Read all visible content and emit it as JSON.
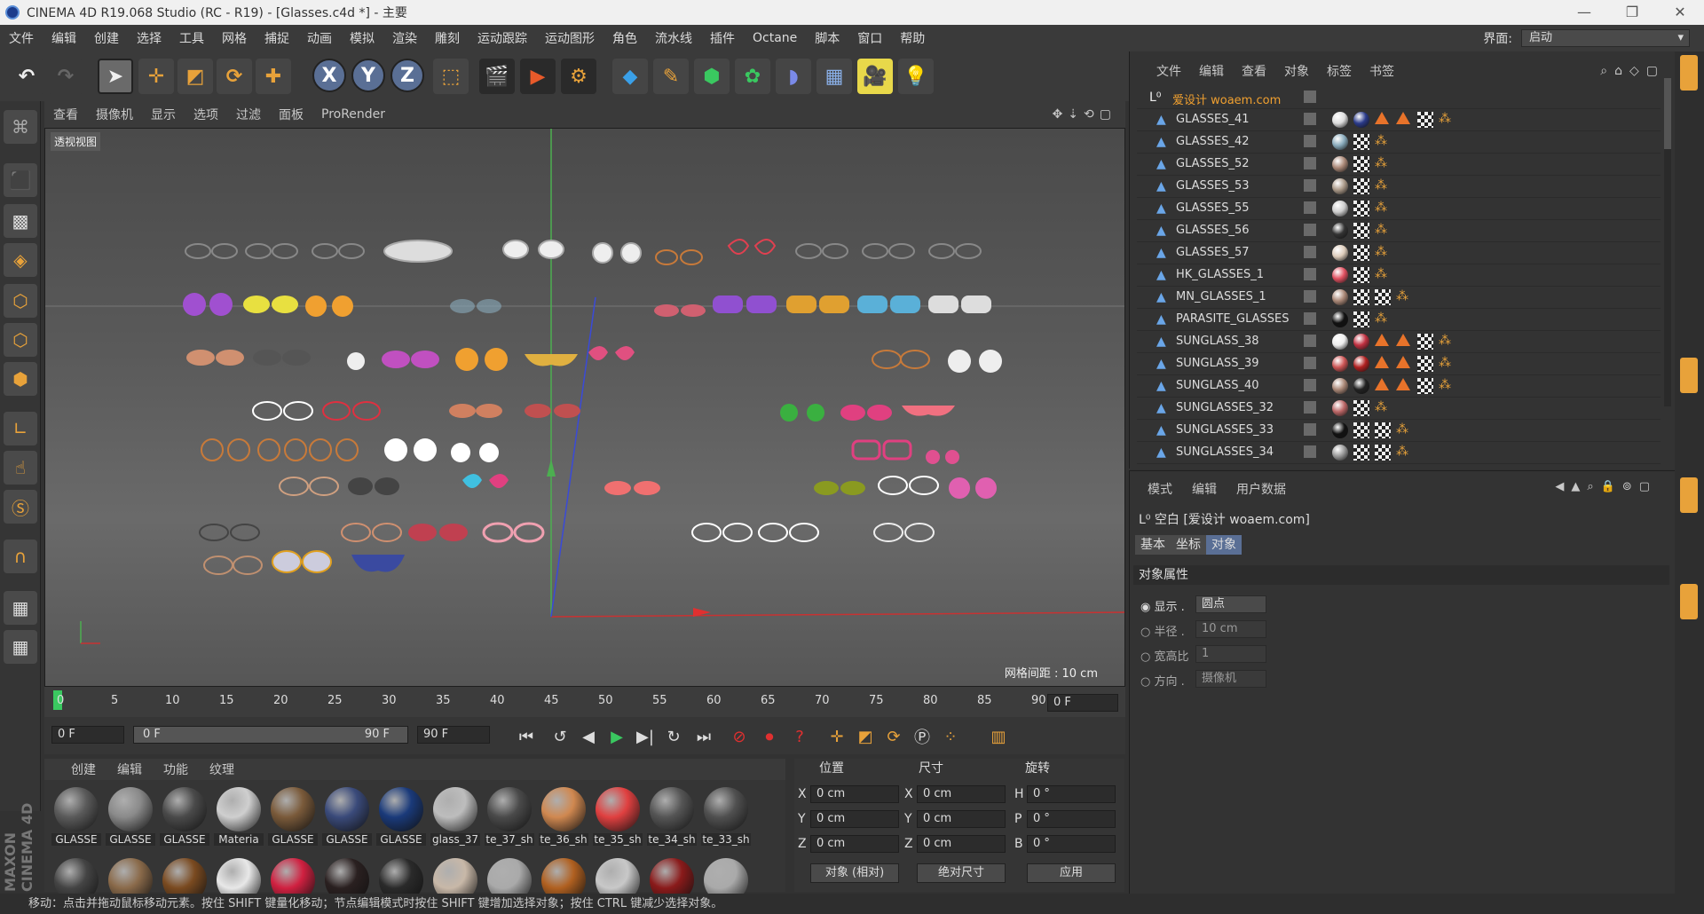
{
  "window": {
    "title": "CINEMA 4D R19.068 Studio (RC - R19) - [Glasses.c4d *] - 主要"
  },
  "menubar": {
    "items": [
      "文件",
      "编辑",
      "创建",
      "选择",
      "工具",
      "网格",
      "捕捉",
      "动画",
      "模拟",
      "渲染",
      "雕刻",
      "运动跟踪",
      "运动图形",
      "角色",
      "流水线",
      "插件",
      "Octane",
      "脚本",
      "窗口",
      "帮助"
    ],
    "layout_label": "界面:",
    "layout_value": "启动"
  },
  "viewport": {
    "menu": [
      "查看",
      "摄像机",
      "显示",
      "选项",
      "过滤",
      "面板",
      "ProRender"
    ],
    "view_name": "透视视图",
    "grid_spacing": "网格间距 : 10 cm"
  },
  "timeline": {
    "ticks": [
      "0",
      "5",
      "10",
      "15",
      "20",
      "25",
      "30",
      "35",
      "40",
      "45",
      "50",
      "55",
      "60",
      "65",
      "70",
      "75",
      "80",
      "85",
      "90"
    ],
    "current_frame": "0 F",
    "start_frame": "0 F",
    "range_start": "0 F",
    "range_end": "90 F",
    "end_frame": "90 F"
  },
  "materials": {
    "menu": [
      "创建",
      "编辑",
      "功能",
      "纹理"
    ],
    "items": [
      {
        "name": "GLASSE",
        "color": "#5a5a5a"
      },
      {
        "name": "GLASSE",
        "color": "#8a8a8a"
      },
      {
        "name": "GLASSE",
        "color": "#4a4a4a"
      },
      {
        "name": "Materia",
        "color": "#cfcfcf"
      },
      {
        "name": "GLASSE",
        "color": "#7a5a3a"
      },
      {
        "name": "GLASSE",
        "color": "#3a4a7a"
      },
      {
        "name": "GLASSE",
        "color": "#1a3a7a"
      },
      {
        "name": "glass_37",
        "color": "#bdbdbd"
      },
      {
        "name": "te_37_sh",
        "color": "#4a4a4a"
      },
      {
        "name": "te_36_sh",
        "color": "#d08850"
      },
      {
        "name": "te_35_sh",
        "color": "#e04040"
      },
      {
        "name": "te_34_sh",
        "color": "#555555"
      },
      {
        "name": "te_33_sh",
        "color": "#505050"
      }
    ],
    "row2_colors": [
      "#444",
      "#8a6a4a",
      "#7a4a20",
      "#e8e8e8",
      "#d02040",
      "#2a2020",
      "#2a2a2a",
      "#c8b8a8",
      "#aaaaaa",
      "#b06020",
      "#c8c8c8",
      "#8a1a1a",
      "#aaaaaa"
    ]
  },
  "coordinates": {
    "headers": {
      "pos": "位置",
      "size": "尺寸",
      "rot": "旋转"
    },
    "rows": [
      {
        "axis": "X",
        "pos": "0 cm",
        "saxis": "X",
        "size": "0 cm",
        "raxis": "H",
        "rot": "0 °"
      },
      {
        "axis": "Y",
        "pos": "0 cm",
        "saxis": "Y",
        "size": "0 cm",
        "raxis": "P",
        "rot": "0 °"
      },
      {
        "axis": "Z",
        "pos": "0 cm",
        "saxis": "Z",
        "size": "0 cm",
        "raxis": "B",
        "rot": "0 °"
      }
    ],
    "mode1": "对象 (相对)",
    "mode2": "绝对尺寸",
    "apply": "应用"
  },
  "status": "移动：点击并拖动鼠标移动元素。按住 SHIFT 键量化移动；节点编辑模式时按住 SHIFT 键增加选择对象；按住 CTRL 键减少选择对象。",
  "objects": {
    "menu": [
      "文件",
      "编辑",
      "查看",
      "对象",
      "标签",
      "书签"
    ],
    "root": "爱设计 woaem.com",
    "items": [
      {
        "name": "GLASSES_41",
        "tags": [
          "#ddd",
          "#2a3a8a",
          "tri",
          "tri",
          "checker",
          "dots"
        ]
      },
      {
        "name": "GLASSES_42",
        "tags": [
          "#8ab",
          "checker",
          "dots"
        ]
      },
      {
        "name": "GLASSES_52",
        "tags": [
          "#a87",
          "checker",
          "dots"
        ]
      },
      {
        "name": "GLASSES_53",
        "tags": [
          "#a98",
          "checker",
          "dots"
        ]
      },
      {
        "name": "GLASSES_55",
        "tags": [
          "#ccc",
          "checker",
          "dots"
        ]
      },
      {
        "name": "GLASSES_56",
        "tags": [
          "#333",
          "checker",
          "dots"
        ]
      },
      {
        "name": "GLASSES_57",
        "tags": [
          "#dcb",
          "checker",
          "dots"
        ]
      },
      {
        "name": "HK_GLASSES_1",
        "tags": [
          "#e05060",
          "checker",
          "dots"
        ]
      },
      {
        "name": "MN_GLASSES_1",
        "tags": [
          "#a87",
          "checker",
          "checker",
          "dots"
        ]
      },
      {
        "name": "PARASITE_GLASSES",
        "tags": [
          "#111",
          "checker",
          "dots"
        ]
      },
      {
        "name": "SUNGLASS_38",
        "tags": [
          "#eee",
          "#c03040",
          "tri",
          "tri",
          "checker",
          "dots"
        ]
      },
      {
        "name": "SUNGLASS_39",
        "tags": [
          "#c55",
          "#b02020",
          "tri",
          "tri",
          "checker",
          "dots"
        ]
      },
      {
        "name": "SUNGLASS_40",
        "tags": [
          "#a87",
          "#222",
          "tri",
          "tri",
          "checker",
          "dots"
        ]
      },
      {
        "name": "SUNGLASSES_32",
        "tags": [
          "#b66",
          "checker",
          "dots"
        ]
      },
      {
        "name": "SUNGLASSES_33",
        "tags": [
          "#111",
          "checker",
          "checker",
          "dots"
        ]
      },
      {
        "name": "SUNGLASSES_34",
        "tags": [
          "#999",
          "checker",
          "checker",
          "dots"
        ]
      }
    ]
  },
  "attributes": {
    "menu": [
      "模式",
      "编辑",
      "用户数据"
    ],
    "title": "空白 [爱设计 woaem.com]",
    "tabs": [
      "基本",
      "坐标",
      "对象"
    ],
    "section": "对象属性",
    "props": [
      {
        "label": "显示",
        "value": "圆点"
      },
      {
        "label": "半径",
        "value": "10 cm"
      },
      {
        "label": "宽高比",
        "value": "1"
      },
      {
        "label": "方向",
        "value": "摄像机"
      }
    ]
  },
  "brand": "MAXON CINEMA 4D"
}
